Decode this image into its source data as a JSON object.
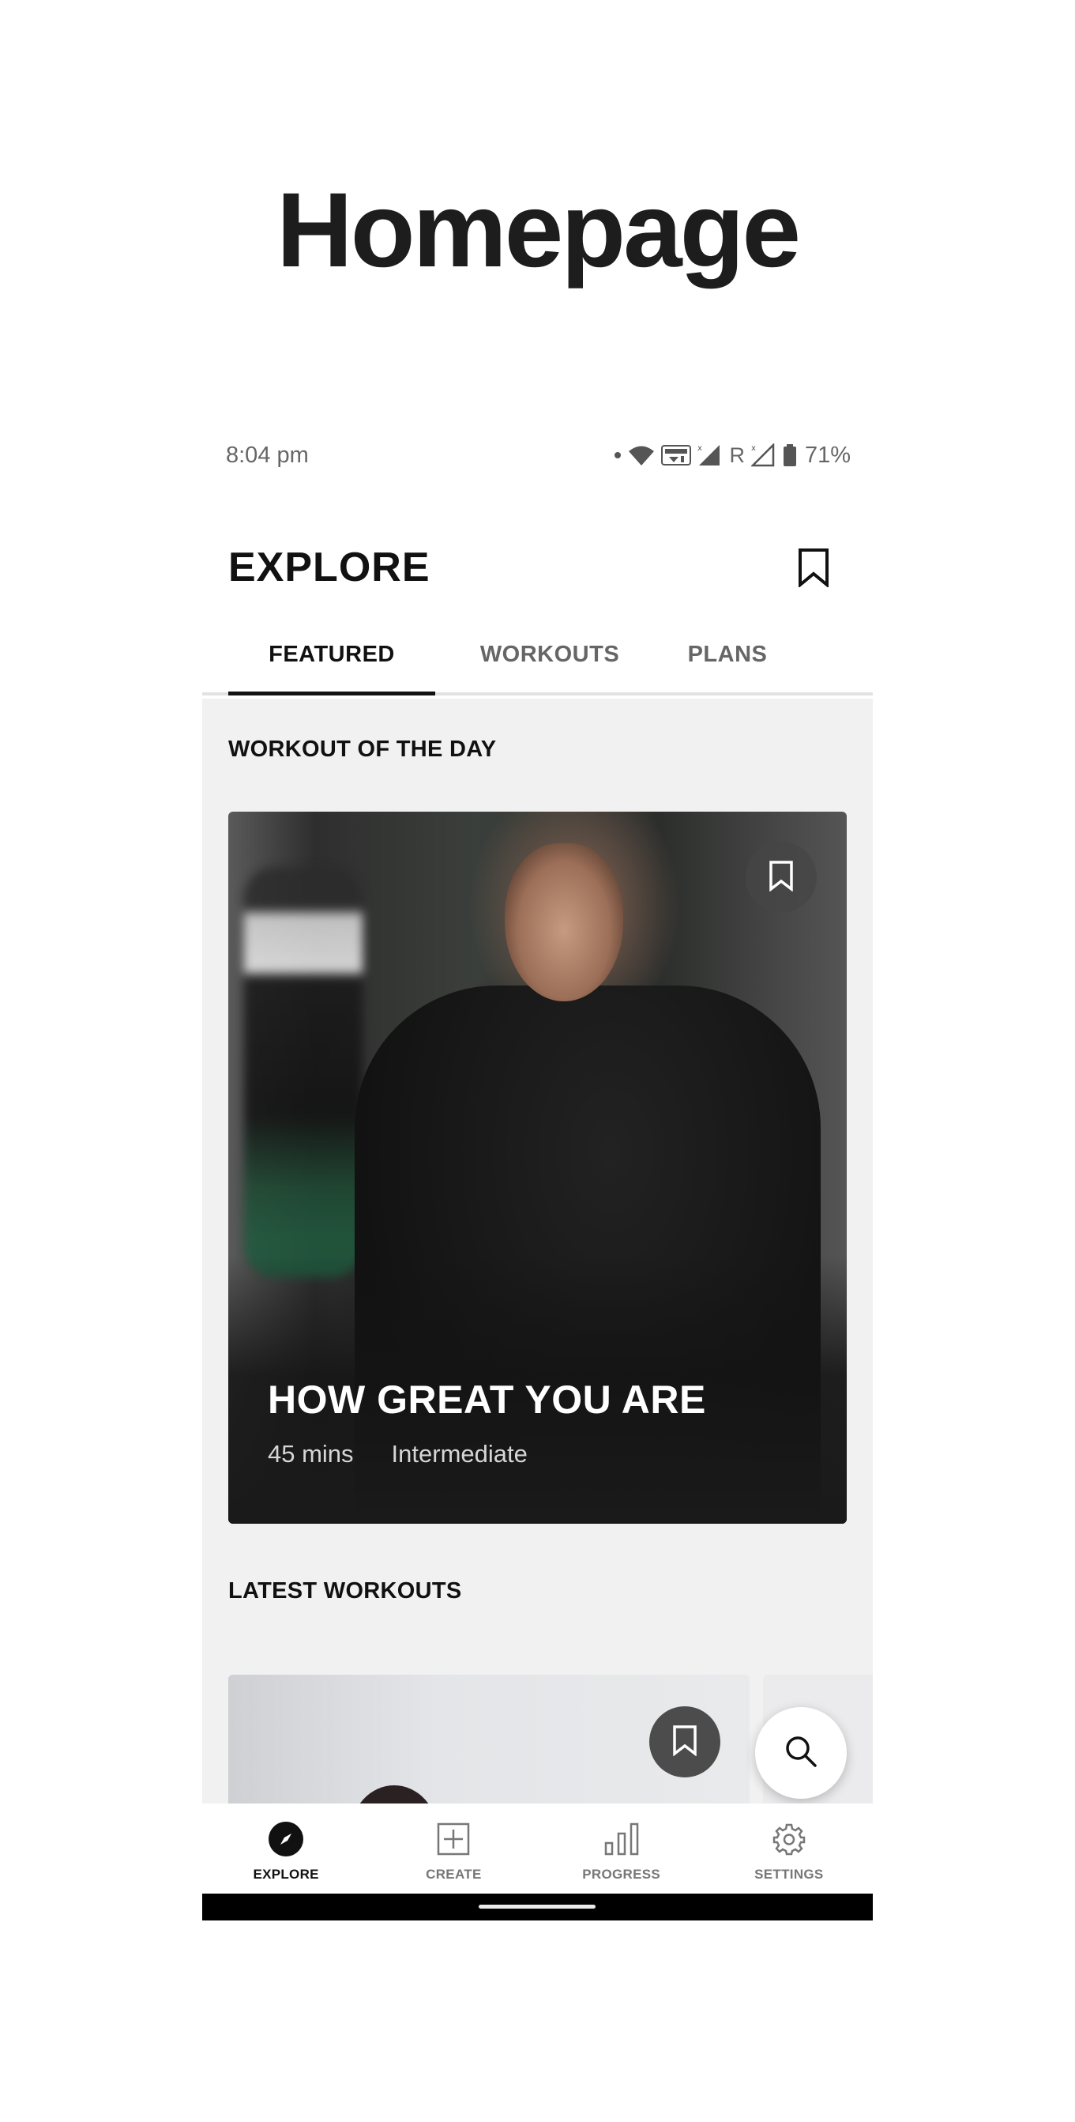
{
  "page_heading": "Homepage",
  "status_bar": {
    "time": "8:04 pm",
    "roaming": "R",
    "battery": "71%",
    "icons": [
      "dot-icon",
      "wifi-icon",
      "volte-icon",
      "signal-icon",
      "signal-icon",
      "battery-icon"
    ]
  },
  "header": {
    "title": "EXPLORE",
    "bookmark_icon": "bookmark-icon"
  },
  "tabs": [
    {
      "label": "FEATURED",
      "active": true
    },
    {
      "label": "WORKOUTS",
      "active": false
    },
    {
      "label": "PLANS",
      "active": false
    }
  ],
  "workout_of_the_day": {
    "section_label": "WORKOUT OF THE DAY",
    "title": "HOW GREAT YOU ARE",
    "duration": "45 mins",
    "level": "Intermediate"
  },
  "latest_workouts": {
    "section_label": "LATEST WORKOUTS"
  },
  "fab": {
    "icon": "search-icon"
  },
  "bottom_nav": [
    {
      "label": "EXPLORE",
      "icon": "compass-icon",
      "active": true
    },
    {
      "label": "CREATE",
      "icon": "plus-square-icon",
      "active": false
    },
    {
      "label": "PROGRESS",
      "icon": "bar-chart-icon",
      "active": false
    },
    {
      "label": "SETTINGS",
      "icon": "gear-icon",
      "active": false
    }
  ],
  "colors": {
    "accent": "#111111",
    "content_background": "#f1f1f1",
    "inactive_text": "#666666"
  }
}
